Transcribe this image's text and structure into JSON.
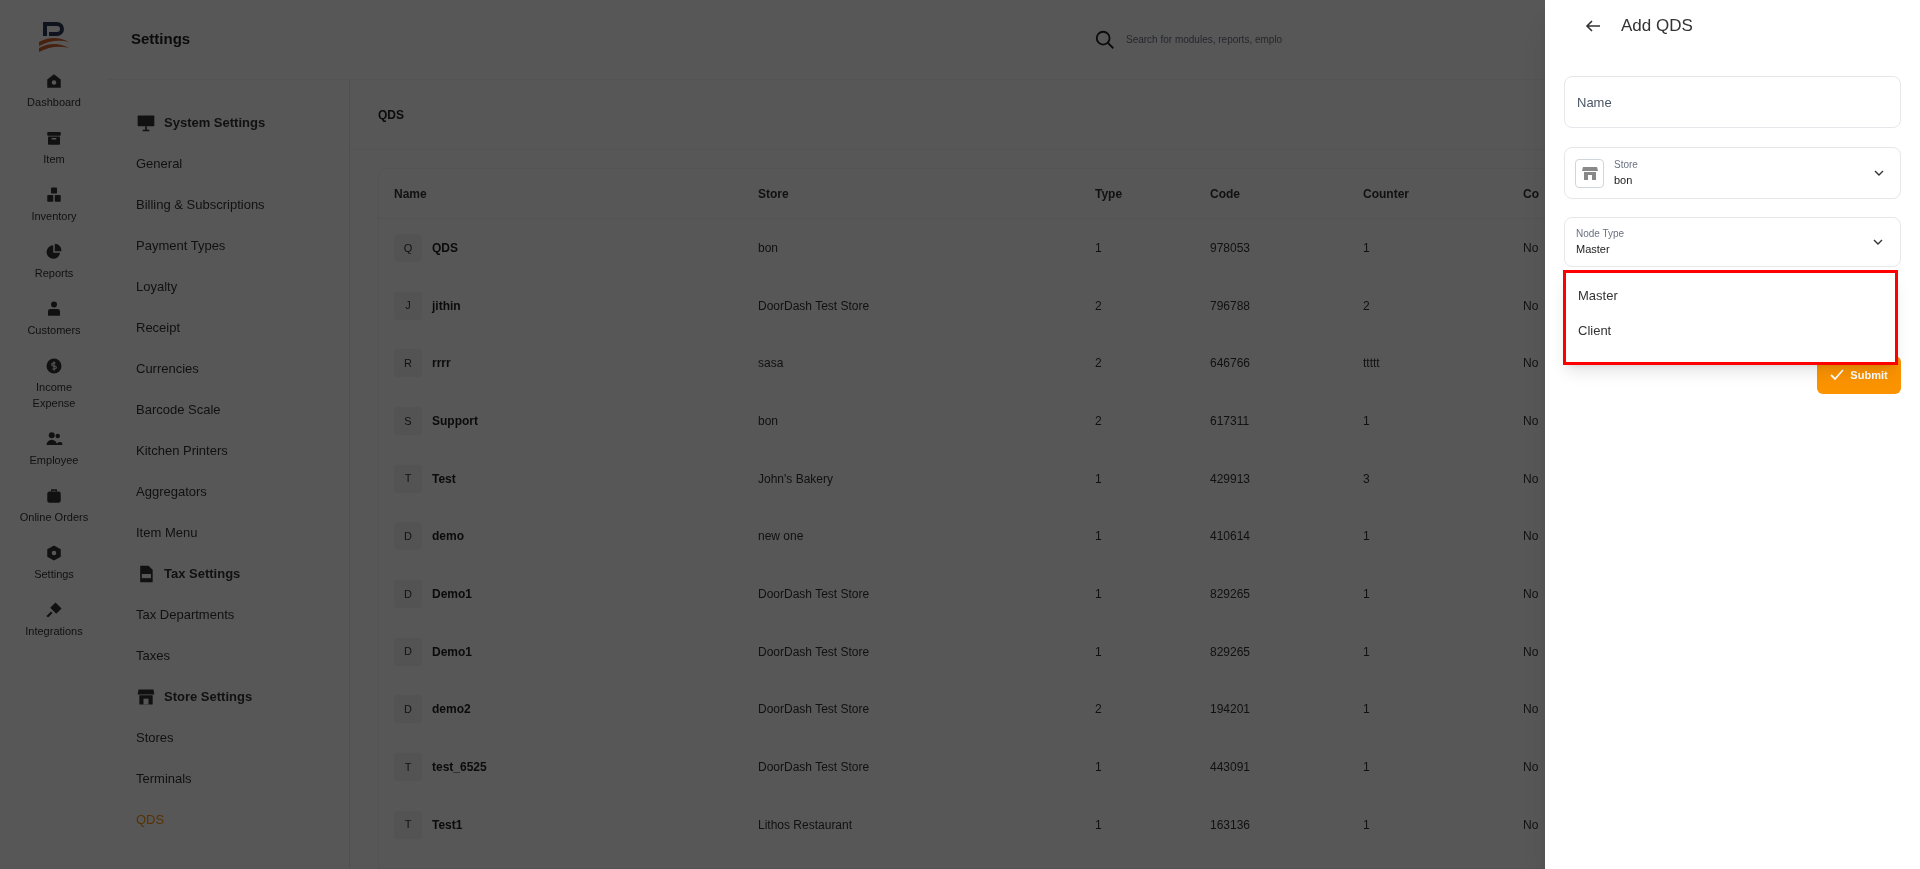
{
  "header": {
    "title": "Settings",
    "search": {
      "placeholder": "Search for modules, reports, emplo"
    }
  },
  "nav": [
    {
      "label": "Dashboard"
    },
    {
      "label": "Item"
    },
    {
      "label": "Inventory"
    },
    {
      "label": "Reports"
    },
    {
      "label": "Customers"
    },
    {
      "label": "Income Expense"
    },
    {
      "label": "Employee"
    },
    {
      "label": "Online Orders"
    },
    {
      "label": "Settings"
    },
    {
      "label": "Integrations"
    }
  ],
  "sidebar": {
    "sections": [
      {
        "title": "System Settings",
        "items": [
          {
            "label": "General",
            "selected": false
          },
          {
            "label": "Billing & Subscriptions",
            "selected": false
          },
          {
            "label": "Payment Types",
            "selected": false
          },
          {
            "label": "Loyalty",
            "selected": false
          },
          {
            "label": "Receipt",
            "selected": false
          },
          {
            "label": "Currencies",
            "selected": false
          },
          {
            "label": "Barcode Scale",
            "selected": false
          },
          {
            "label": "Kitchen Printers",
            "selected": false
          },
          {
            "label": "Aggregators",
            "selected": false
          },
          {
            "label": "Item Menu",
            "selected": false
          }
        ]
      },
      {
        "title": "Tax Settings",
        "items": [
          {
            "label": "Tax Departments",
            "selected": false
          },
          {
            "label": "Taxes",
            "selected": false
          }
        ]
      },
      {
        "title": "Store Settings",
        "items": [
          {
            "label": "Stores",
            "selected": false
          },
          {
            "label": "Terminals",
            "selected": false
          },
          {
            "label": "QDS",
            "selected": true
          }
        ]
      }
    ]
  },
  "page": {
    "title": "QDS"
  },
  "table": {
    "columns": [
      "Name",
      "Store",
      "Type",
      "Code",
      "Counter",
      "Co"
    ],
    "rows": [
      {
        "initial": "Q",
        "name": "QDS",
        "store": "bon",
        "type": "1",
        "code": "978053",
        "counter": "1",
        "column_6": "No"
      },
      {
        "initial": "J",
        "name": "jithin",
        "store": "DoorDash Test Store",
        "type": "2",
        "code": "796788",
        "counter": "2",
        "column_6": "No"
      },
      {
        "initial": "R",
        "name": "rrrr",
        "store": "sasa",
        "type": "2",
        "code": "646766",
        "counter": "ttttt",
        "column_6": "No"
      },
      {
        "initial": "S",
        "name": "Support",
        "store": "bon",
        "type": "2",
        "code": "617311",
        "counter": "1",
        "column_6": "No"
      },
      {
        "initial": "T",
        "name": "Test",
        "store": "John's Bakery",
        "type": "1",
        "code": "429913",
        "counter": "3",
        "column_6": "No"
      },
      {
        "initial": "D",
        "name": "demo",
        "store": "new one",
        "type": "1",
        "code": "410614",
        "counter": "1",
        "column_6": "No"
      },
      {
        "initial": "D",
        "name": "Demo1",
        "store": "DoorDash Test Store",
        "type": "1",
        "code": "829265",
        "counter": "1",
        "column_6": "No"
      },
      {
        "initial": "D",
        "name": "Demo1",
        "store": "DoorDash Test Store",
        "type": "1",
        "code": "829265",
        "counter": "1",
        "column_6": "No"
      },
      {
        "initial": "D",
        "name": "demo2",
        "store": "DoorDash Test Store",
        "type": "2",
        "code": "194201",
        "counter": "1",
        "column_6": "No"
      },
      {
        "initial": "T",
        "name": "test_6525",
        "store": "DoorDash Test Store",
        "type": "1",
        "code": "443091",
        "counter": "1",
        "column_6": "No"
      },
      {
        "initial": "T",
        "name": "Test1",
        "store": "Lithos Restaurant",
        "type": "1",
        "code": "163136",
        "counter": "1",
        "column_6": "No"
      }
    ]
  },
  "panel": {
    "title": "Add QDS",
    "name_field": {
      "placeholder": "Name"
    },
    "store_field": {
      "label": "Store",
      "value": "bon"
    },
    "node_type_field": {
      "label": "Node Type",
      "value": "Master"
    },
    "options": [
      "Master",
      "Client"
    ],
    "submit": "Submit"
  }
}
